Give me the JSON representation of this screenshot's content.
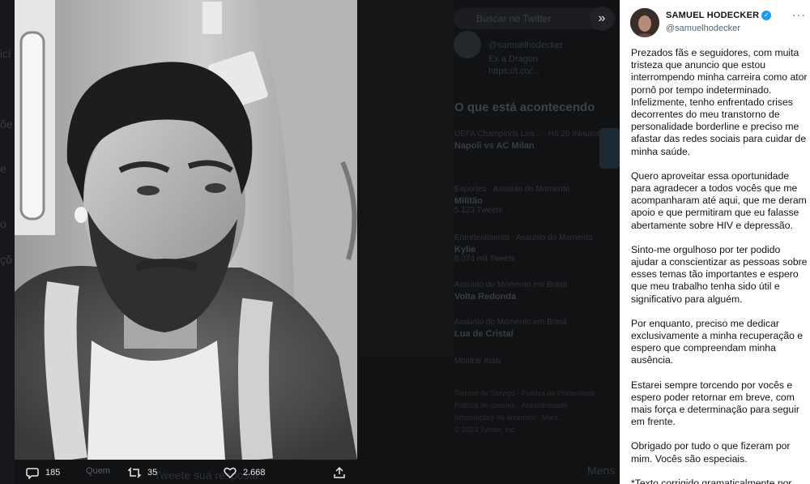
{
  "background": {
    "left_fragments": [
      "ici",
      "õe",
      "e",
      "o",
      "çõ"
    ],
    "search_placeholder": "Buscar no Twitter",
    "card_lines": [
      "@samuelhodecker",
      "Ex a Dragon",
      "https://t.co/..."
    ],
    "trends_heading": "O que está acontecendo",
    "trends": [
      {
        "meta": "UEFA Champions Lea... · Há 20 minutos",
        "title": "Napoli vs AC Milan"
      },
      {
        "meta": "Esportes · Assunto do Momento",
        "title": "Militão",
        "count": "5.123 Tweets"
      },
      {
        "meta": "Entretenimento · Assunto do Momento",
        "title": "Kylie",
        "count": "8.074 mil Tweets"
      },
      {
        "meta": "Assunto do Momento em Brasil",
        "title": "Volta Redonda"
      },
      {
        "meta": "Assunto do Momento em Brasil",
        "title": "Lua de Cristal"
      }
    ],
    "show_more": "Mostrar mais",
    "footer": [
      "Termos de Serviço · Política de Privacidade",
      "Política de cookies · Acessibilidade",
      "Informações de anúncios · Mais ...",
      "© 2023 Twitter, Inc."
    ],
    "bottom_right": "Mens",
    "bottom_reply": "Tweete sua resposta"
  },
  "media": {
    "expand_icon": "chevrons-right-icon"
  },
  "actions": {
    "replies": "185",
    "retweets": "35",
    "likes": "2.668",
    "quote_label": "Quem"
  },
  "tweet": {
    "display_name": "SAMUEL HODECKER",
    "handle": "@samuelhodecker",
    "verified_color": "#1d9bf0",
    "paragraphs": [
      "Prezados fãs e seguidores, com muita tristeza que anuncio que estou interrompendo minha carreira como ator pornô por tempo indeterminado. Infelizmente, tenho enfrentado crises decorrentes do meu transtorno de personalidade borderline e preciso me afastar das redes sociais para cuidar de minha saúde.",
      "Quero aproveitar essa oportunidade para agradecer a todos vocês que me acompanharam até aqui, que me deram apoio e que permitiram que eu falasse abertamente sobre HIV e depressão.",
      "Sinto-me orgulhoso por ter podido ajudar a conscientizar as pessoas sobre esses temas tão importantes e espero que meu trabalho tenha sido útil e significativo para alguém.",
      "Por enquanto, preciso me dedicar exclusivamente a minha recuperação e espero que compreendam minha ausência.",
      "Estarei sempre torcendo por vocês e espero poder retornar em breve, com mais força e determinação para seguir em frente.",
      "Obrigado por tudo o que fizeram por mim. Vocês são especiais.",
      "*Texto corrigido gramaticalmente por"
    ]
  }
}
